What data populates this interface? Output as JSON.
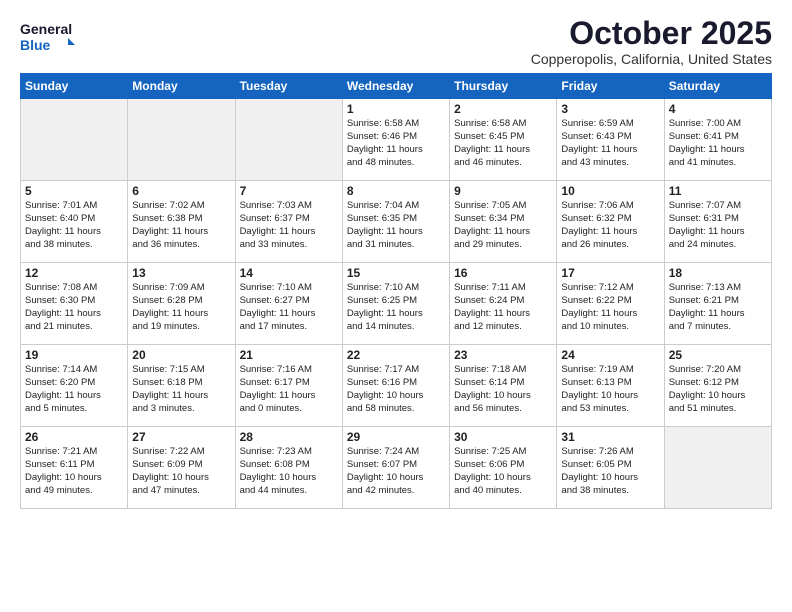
{
  "header": {
    "logo_line1": "General",
    "logo_line2": "Blue",
    "month": "October 2025",
    "location": "Copperopolis, California, United States"
  },
  "weekdays": [
    "Sunday",
    "Monday",
    "Tuesday",
    "Wednesday",
    "Thursday",
    "Friday",
    "Saturday"
  ],
  "weeks": [
    [
      {
        "day": "",
        "info": ""
      },
      {
        "day": "",
        "info": ""
      },
      {
        "day": "",
        "info": ""
      },
      {
        "day": "1",
        "info": "Sunrise: 6:58 AM\nSunset: 6:46 PM\nDaylight: 11 hours\nand 48 minutes."
      },
      {
        "day": "2",
        "info": "Sunrise: 6:58 AM\nSunset: 6:45 PM\nDaylight: 11 hours\nand 46 minutes."
      },
      {
        "day": "3",
        "info": "Sunrise: 6:59 AM\nSunset: 6:43 PM\nDaylight: 11 hours\nand 43 minutes."
      },
      {
        "day": "4",
        "info": "Sunrise: 7:00 AM\nSunset: 6:41 PM\nDaylight: 11 hours\nand 41 minutes."
      }
    ],
    [
      {
        "day": "5",
        "info": "Sunrise: 7:01 AM\nSunset: 6:40 PM\nDaylight: 11 hours\nand 38 minutes."
      },
      {
        "day": "6",
        "info": "Sunrise: 7:02 AM\nSunset: 6:38 PM\nDaylight: 11 hours\nand 36 minutes."
      },
      {
        "day": "7",
        "info": "Sunrise: 7:03 AM\nSunset: 6:37 PM\nDaylight: 11 hours\nand 33 minutes."
      },
      {
        "day": "8",
        "info": "Sunrise: 7:04 AM\nSunset: 6:35 PM\nDaylight: 11 hours\nand 31 minutes."
      },
      {
        "day": "9",
        "info": "Sunrise: 7:05 AM\nSunset: 6:34 PM\nDaylight: 11 hours\nand 29 minutes."
      },
      {
        "day": "10",
        "info": "Sunrise: 7:06 AM\nSunset: 6:32 PM\nDaylight: 11 hours\nand 26 minutes."
      },
      {
        "day": "11",
        "info": "Sunrise: 7:07 AM\nSunset: 6:31 PM\nDaylight: 11 hours\nand 24 minutes."
      }
    ],
    [
      {
        "day": "12",
        "info": "Sunrise: 7:08 AM\nSunset: 6:30 PM\nDaylight: 11 hours\nand 21 minutes."
      },
      {
        "day": "13",
        "info": "Sunrise: 7:09 AM\nSunset: 6:28 PM\nDaylight: 11 hours\nand 19 minutes."
      },
      {
        "day": "14",
        "info": "Sunrise: 7:10 AM\nSunset: 6:27 PM\nDaylight: 11 hours\nand 17 minutes."
      },
      {
        "day": "15",
        "info": "Sunrise: 7:10 AM\nSunset: 6:25 PM\nDaylight: 11 hours\nand 14 minutes."
      },
      {
        "day": "16",
        "info": "Sunrise: 7:11 AM\nSunset: 6:24 PM\nDaylight: 11 hours\nand 12 minutes."
      },
      {
        "day": "17",
        "info": "Sunrise: 7:12 AM\nSunset: 6:22 PM\nDaylight: 11 hours\nand 10 minutes."
      },
      {
        "day": "18",
        "info": "Sunrise: 7:13 AM\nSunset: 6:21 PM\nDaylight: 11 hours\nand 7 minutes."
      }
    ],
    [
      {
        "day": "19",
        "info": "Sunrise: 7:14 AM\nSunset: 6:20 PM\nDaylight: 11 hours\nand 5 minutes."
      },
      {
        "day": "20",
        "info": "Sunrise: 7:15 AM\nSunset: 6:18 PM\nDaylight: 11 hours\nand 3 minutes."
      },
      {
        "day": "21",
        "info": "Sunrise: 7:16 AM\nSunset: 6:17 PM\nDaylight: 11 hours\nand 0 minutes."
      },
      {
        "day": "22",
        "info": "Sunrise: 7:17 AM\nSunset: 6:16 PM\nDaylight: 10 hours\nand 58 minutes."
      },
      {
        "day": "23",
        "info": "Sunrise: 7:18 AM\nSunset: 6:14 PM\nDaylight: 10 hours\nand 56 minutes."
      },
      {
        "day": "24",
        "info": "Sunrise: 7:19 AM\nSunset: 6:13 PM\nDaylight: 10 hours\nand 53 minutes."
      },
      {
        "day": "25",
        "info": "Sunrise: 7:20 AM\nSunset: 6:12 PM\nDaylight: 10 hours\nand 51 minutes."
      }
    ],
    [
      {
        "day": "26",
        "info": "Sunrise: 7:21 AM\nSunset: 6:11 PM\nDaylight: 10 hours\nand 49 minutes."
      },
      {
        "day": "27",
        "info": "Sunrise: 7:22 AM\nSunset: 6:09 PM\nDaylight: 10 hours\nand 47 minutes."
      },
      {
        "day": "28",
        "info": "Sunrise: 7:23 AM\nSunset: 6:08 PM\nDaylight: 10 hours\nand 44 minutes."
      },
      {
        "day": "29",
        "info": "Sunrise: 7:24 AM\nSunset: 6:07 PM\nDaylight: 10 hours\nand 42 minutes."
      },
      {
        "day": "30",
        "info": "Sunrise: 7:25 AM\nSunset: 6:06 PM\nDaylight: 10 hours\nand 40 minutes."
      },
      {
        "day": "31",
        "info": "Sunrise: 7:26 AM\nSunset: 6:05 PM\nDaylight: 10 hours\nand 38 minutes."
      },
      {
        "day": "",
        "info": ""
      }
    ]
  ]
}
